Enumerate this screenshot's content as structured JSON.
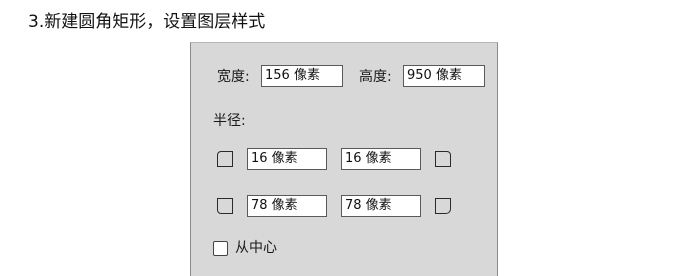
{
  "heading": "3.新建圆角矩形，设置图层样式",
  "panel": {
    "width_label": "宽度:",
    "width_value": "156 像素",
    "height_label": "高度:",
    "height_value": "950 像素",
    "radius_label": "半径:",
    "radius_top_left": "16 像素",
    "radius_top_right": "16 像素",
    "radius_bottom_left": "78 像素",
    "radius_bottom_right": "78 像素",
    "from_center_label": "从中心",
    "from_center_checked": false
  },
  "icons": {
    "top_left": "corner-top-left-icon",
    "top_right": "corner-top-right-icon",
    "bottom_left": "corner-bottom-left-icon",
    "bottom_right": "corner-bottom-right-icon"
  }
}
